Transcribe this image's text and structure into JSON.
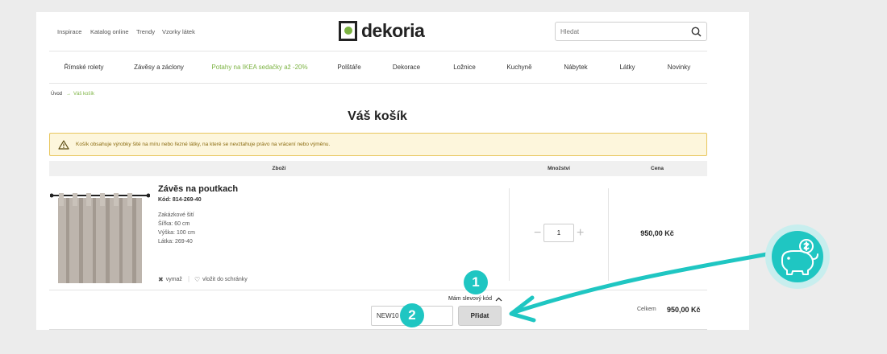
{
  "header": {
    "top_links": [
      "Inspirace",
      "Katalog online",
      "Trendy",
      "Vzorky látek"
    ],
    "logo_text": "dekoria",
    "search_placeholder": "Hledat"
  },
  "categories": [
    {
      "label": "Římské rolety",
      "promo": false
    },
    {
      "label": "Závěsy a záclony",
      "promo": false
    },
    {
      "label": "Potahy na IKEA sedačky až -20%",
      "promo": true
    },
    {
      "label": "Polštáře",
      "promo": false
    },
    {
      "label": "Dekorace",
      "promo": false
    },
    {
      "label": "Ložnice",
      "promo": false
    },
    {
      "label": "Kuchyně",
      "promo": false
    },
    {
      "label": "Nábytek",
      "promo": false
    },
    {
      "label": "Látky",
      "promo": false
    },
    {
      "label": "Novinky",
      "promo": false
    }
  ],
  "breadcrumb": {
    "home": "Úvod",
    "arrow": "→",
    "current": "Váš košík"
  },
  "page_title": "Váš košík",
  "warning": "Košík obsahuje výrobky šité na míru nebo řezné látky, na které se nevztahuje právo na vrácení nebo výměnu.",
  "table_headers": {
    "product": "Zboží",
    "quantity": "Množství",
    "price": "Cena"
  },
  "item": {
    "name": "Závěs na poutkach",
    "code": "Kód: 814-269-40",
    "specs": [
      "Zakázkové šití",
      "Šířka: 60 cm",
      "Výška: 100 cm",
      "Látka: 269-40"
    ],
    "remove": "vymaž",
    "save": "vložit do schránky",
    "quantity": "1",
    "price": "950,00 Kč"
  },
  "discount": {
    "toggle_label": "Mám slevový kód",
    "code_value": "NEW10",
    "add_button": "Přidat"
  },
  "total": {
    "label": "Celkem",
    "value": "950,00 Kč"
  },
  "badges": [
    "1",
    "2"
  ],
  "colors": {
    "brand_green": "#7cb342",
    "accent_teal": "#1fc6c2",
    "warning_bg": "#fdf6dc"
  },
  "icons": [
    "search-icon",
    "warning-icon",
    "close-icon",
    "heart-icon",
    "chevron-up-icon",
    "piggy-bank-icon"
  ]
}
